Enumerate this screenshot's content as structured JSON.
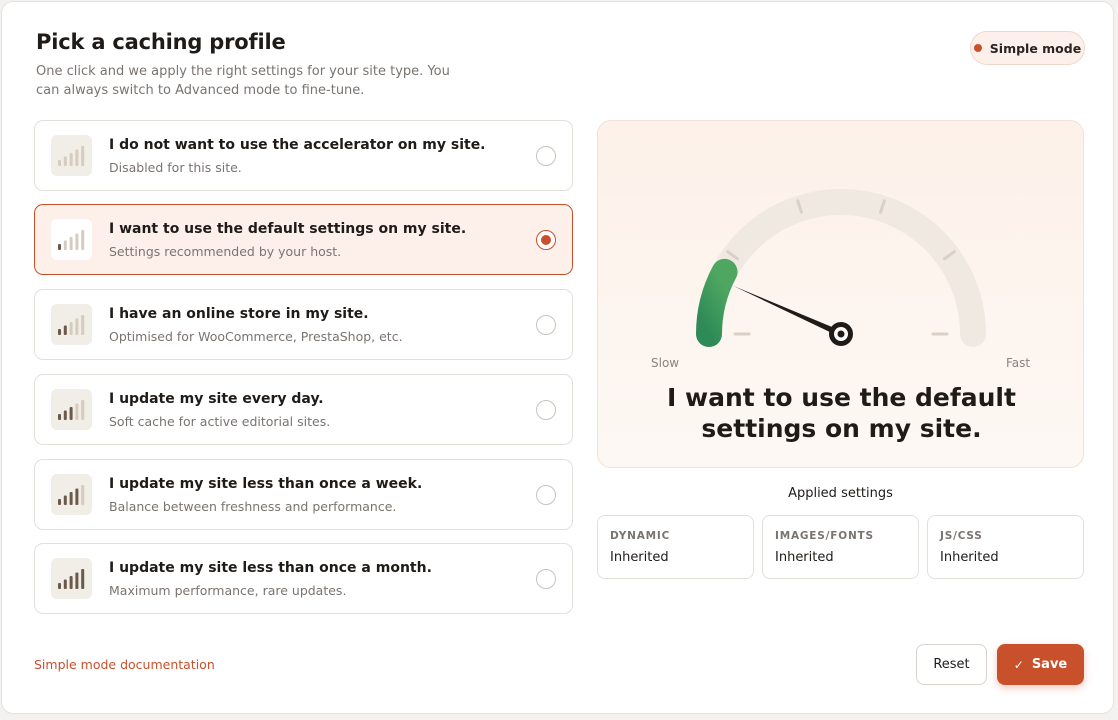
{
  "header": {
    "title": "Pick a caching profile",
    "subtitle": "One click and we apply the right settings for your site type. You can always switch to Advanced mode to fine-tune.",
    "mode_badge": "Simple mode"
  },
  "options": [
    {
      "title": "I do not want to use the accelerator on my site.",
      "description": "Disabled for this site.",
      "level": 0,
      "selected": false
    },
    {
      "title": "I want to use the default settings on my site.",
      "description": "Settings recommended by your host.",
      "level": 1,
      "selected": true
    },
    {
      "title": "I have an online store in my site.",
      "description": "Optimised for WooCommerce, PrestaShop, etc.",
      "level": 2,
      "selected": false
    },
    {
      "title": "I update my site every day.",
      "description": "Soft cache for active editorial sites.",
      "level": 3,
      "selected": false
    },
    {
      "title": "I update my site less than once a week.",
      "description": "Balance between freshness and performance.",
      "level": 4,
      "selected": false
    },
    {
      "title": "I update my site less than once a month.",
      "description": "Maximum performance, rare updates.",
      "level": 5,
      "selected": false
    }
  ],
  "gauge": {
    "min_label": "Slow",
    "max_label": "Fast",
    "level_fraction": 0.2,
    "caption": "I want to use the default settings on my site."
  },
  "applied_settings": {
    "title": "Applied settings",
    "items": [
      {
        "name": "DYNAMIC",
        "value": "Inherited"
      },
      {
        "name": "IMAGES/FONTS",
        "value": "Inherited"
      },
      {
        "name": "JS/CSS",
        "value": "Inherited"
      }
    ]
  },
  "footer": {
    "doc_link": "Simple mode documentation",
    "reset_label": "Reset",
    "save_label": "Save"
  },
  "colors": {
    "accent": "#c8502b",
    "gauge_fill": "#2e8b57",
    "bar_active": "#6b5a4a",
    "bar_inactive": "#d6cbbd"
  },
  "icons": {
    "option_icon": "signal-bars-icon",
    "save_icon": "check-icon"
  }
}
